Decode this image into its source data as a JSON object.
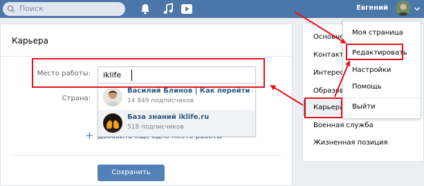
{
  "topbar": {
    "search_placeholder": "Поиск",
    "icons": [
      "search-icon",
      "bell-icon",
      "music-icon",
      "video-play-icon",
      "chevron-down-icon"
    ],
    "user_name": "Евгений"
  },
  "main": {
    "title": "Карьера",
    "workplace_label": "Место работы:",
    "workplace_value": "iklife",
    "country_label": "Страна:",
    "suggestions": [
      {
        "name": "Василий Блинов | Как перейти на уда...",
        "subscribers": "14 849 подписчиков"
      },
      {
        "name": "База знаний iklife.ru",
        "subscribers": "518 подписчиков"
      }
    ],
    "add_another": "Добавить ещё одно место работы",
    "save_label": "Сохранить"
  },
  "side_menu": {
    "items": [
      "Основное",
      "Контакты",
      "Интересы",
      "Образование",
      "Карьера",
      "Военная служба",
      "Жизненная позиция"
    ],
    "selected": "Карьера"
  },
  "dropdown_menu": {
    "items": [
      "Моя страница",
      "Редактировать",
      "Настройки",
      "Помощь",
      "Выйти"
    ]
  },
  "colors": {
    "header_blue": "#4a76a8",
    "button_blue": "#5181b8",
    "link_blue": "#2a5885",
    "highlight_red": "#e6101a"
  }
}
